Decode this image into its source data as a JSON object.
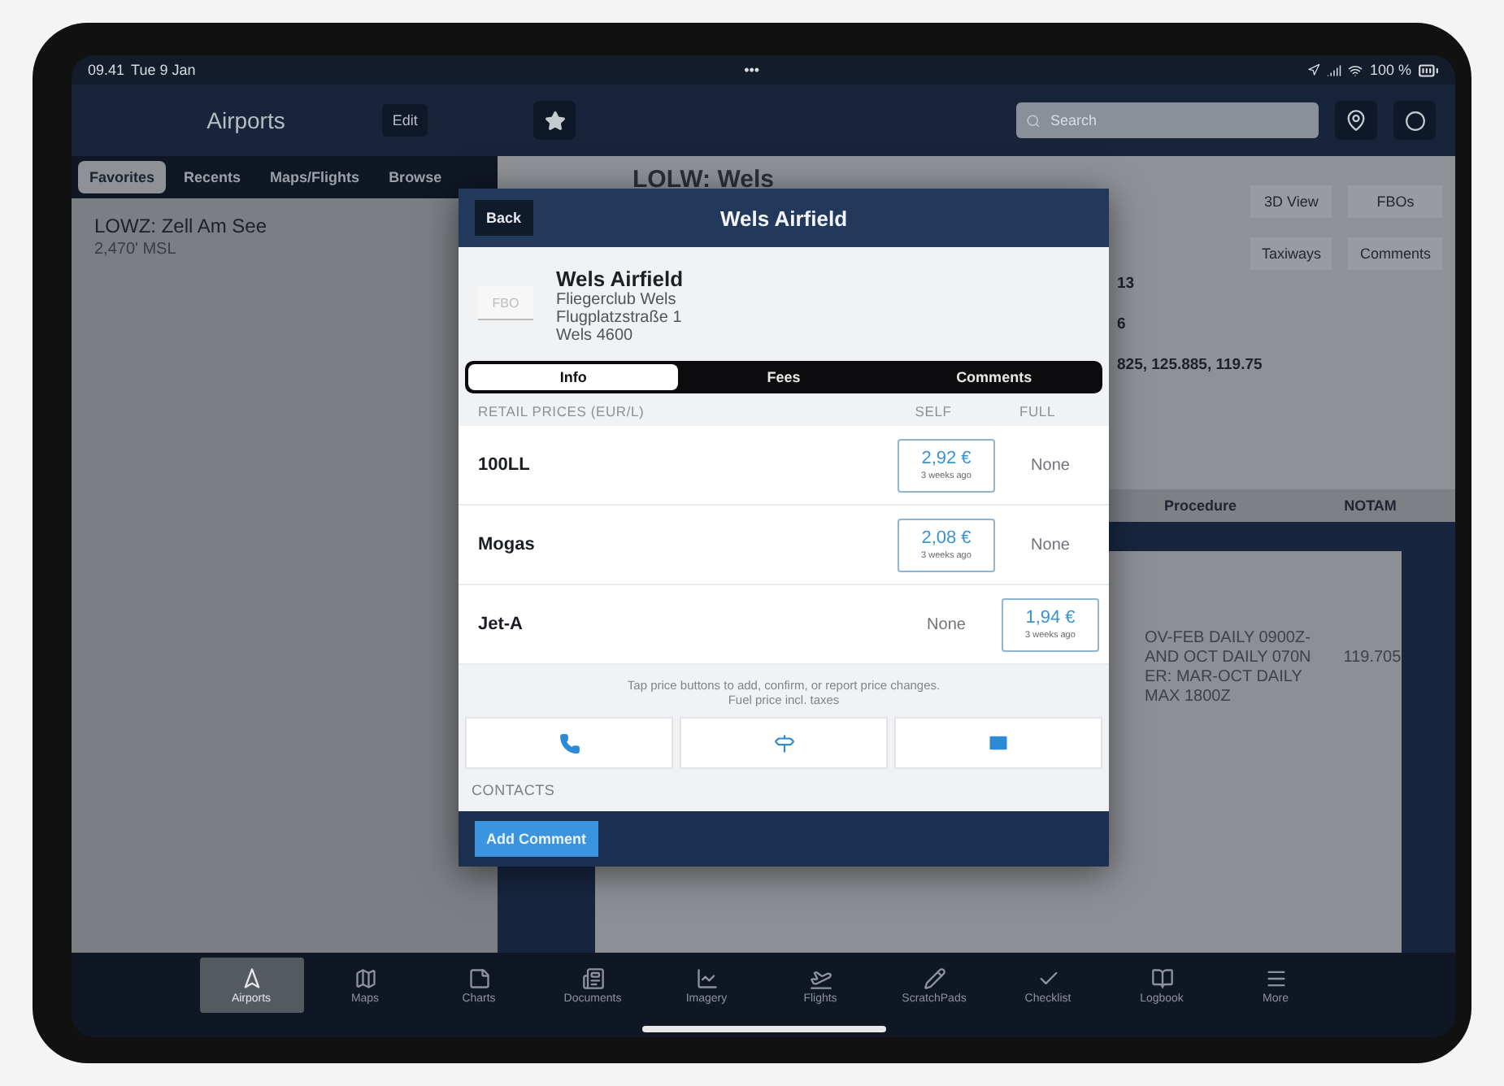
{
  "status_bar": {
    "time": "09.41",
    "date": "Tue 9 Jan",
    "dots": "•••",
    "battery": "100 %"
  },
  "sidebar": {
    "title": "Airports",
    "edit": "Edit",
    "tabs": [
      {
        "label": "Favorites",
        "selected": true
      },
      {
        "label": "Recents",
        "selected": false
      },
      {
        "label": "Maps/Flights",
        "selected": false
      },
      {
        "label": "Browse",
        "selected": false
      }
    ],
    "items": [
      {
        "name": "LOWZ: Zell Am See",
        "elevation": "2,470' MSL"
      }
    ]
  },
  "search": {
    "placeholder": "Search"
  },
  "airport": {
    "title": "LOLW: Wels",
    "buttons": [
      "3D View",
      "FBOs",
      "Taxiways",
      "Comments"
    ],
    "info_lines": [
      "13",
      "6",
      "825, 125.885, 119.75"
    ],
    "tabs": [
      "Procedure",
      "NOTAM"
    ],
    "notes": [
      "OV-FEB DAILY 0900Z-",
      "AND OCT DAILY 070N",
      "ER: MAR-OCT DAILY",
      "MAX 1800Z"
    ],
    "frequency": "119.705"
  },
  "modal": {
    "back": "Back",
    "title": "Wels Airfield",
    "logo": "FBO",
    "name": "Wels Airfield",
    "address": [
      "Fliegerclub Wels",
      "Flugplatzstraße 1",
      "Wels 4600"
    ],
    "tabs": [
      {
        "label": "Info",
        "selected": true
      },
      {
        "label": "Fees",
        "selected": false
      },
      {
        "label": "Comments",
        "selected": false
      }
    ],
    "prices_header": {
      "label": "RETAIL PRICES (EUR/L)",
      "self": "SELF",
      "full": "FULL"
    },
    "fuels": [
      {
        "name": "100LL",
        "self": {
          "kind": "price",
          "price": "2,92 €",
          "age": "3 weeks ago"
        },
        "full": {
          "kind": "none",
          "text": "None"
        }
      },
      {
        "name": "Mogas",
        "self": {
          "kind": "price",
          "price": "2,08 €",
          "age": "3 weeks ago"
        },
        "full": {
          "kind": "none",
          "text": "None"
        }
      },
      {
        "name": "Jet-A",
        "self": {
          "kind": "none",
          "text": "None"
        },
        "full": {
          "kind": "price",
          "price": "1,94 €",
          "age": "3 weeks ago"
        }
      }
    ],
    "note": [
      "Tap price buttons to add, confirm, or report price changes.",
      "Fuel price incl. taxes"
    ],
    "contacts": "CONTACTS",
    "add_comment": "Add Comment"
  },
  "tab_bar": [
    {
      "label": "Airports",
      "selected": true
    },
    {
      "label": "Maps",
      "selected": false
    },
    {
      "label": "Charts",
      "selected": false
    },
    {
      "label": "Documents",
      "selected": false
    },
    {
      "label": "Imagery",
      "selected": false
    },
    {
      "label": "Flights",
      "selected": false
    },
    {
      "label": "ScratchPads",
      "selected": false
    },
    {
      "label": "Checklist",
      "selected": false
    },
    {
      "label": "Logbook",
      "selected": false
    },
    {
      "label": "More",
      "selected": false
    }
  ]
}
